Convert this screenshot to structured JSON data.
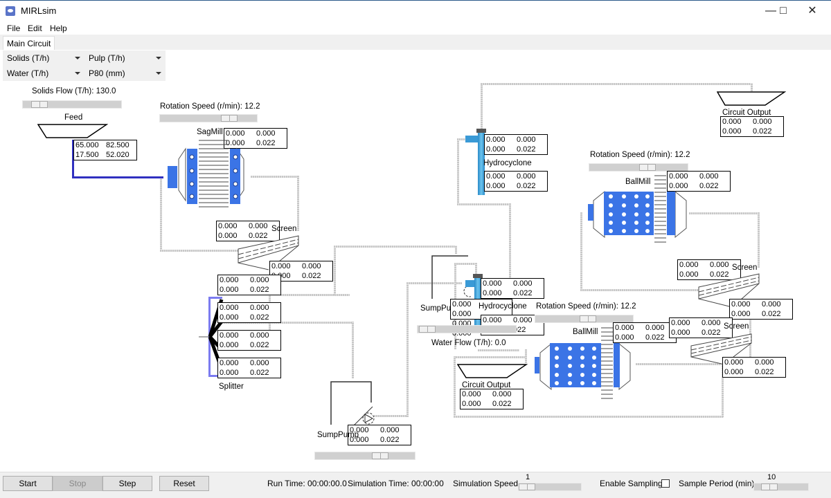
{
  "window": {
    "title": "MIRLsim",
    "minimize_icon": "minimize-icon",
    "maximize_icon": "maximize-icon",
    "close_icon": "close-icon"
  },
  "menu": [
    "File",
    "Edit",
    "Help"
  ],
  "tabs": [
    {
      "label": "Main Circuit",
      "active": true
    }
  ],
  "dropdowns": {
    "top_left": "Solids (T/h)",
    "top_right": "Pulp (T/h)",
    "bottom_left": "Water (T/h)",
    "bottom_right": "P80 (mm)"
  },
  "units": {
    "feed": {
      "label": "Feed",
      "slider_label": "Solids Flow (T/h): 130.0",
      "slider_fraction": 0.1,
      "values": [
        [
          "65.000",
          "82.500"
        ],
        [
          "17.500",
          "52.020"
        ]
      ]
    },
    "sagmill": {
      "label": "SagMill",
      "slider_label": "Rotation Speed (r/min): 12.2",
      "slider_fraction": 0.8,
      "values": [
        [
          "0.000",
          "0.000"
        ],
        [
          "0.000",
          "0.022"
        ]
      ]
    },
    "screen1": {
      "label": "Screen",
      "values_top": [
        [
          "0.000",
          "0.000"
        ],
        [
          "0.000",
          "0.022"
        ]
      ],
      "values_bottom": [
        [
          "0.000",
          "0.000"
        ],
        [
          "0.000",
          "0.022"
        ]
      ]
    },
    "splitter": {
      "label": "Splitter",
      "values": [
        [
          [
            "0.000",
            "0.000"
          ],
          [
            "0.000",
            "0.022"
          ]
        ],
        [
          [
            "0.000",
            "0.000"
          ],
          [
            "0.000",
            "0.022"
          ]
        ],
        [
          [
            "0.000",
            "0.000"
          ],
          [
            "0.000",
            "0.022"
          ]
        ],
        [
          [
            "0.000",
            "0.000"
          ],
          [
            "0.000",
            "0.022"
          ]
        ]
      ]
    },
    "sumppump1": {
      "label": "SumpPump",
      "slider_fraction": 0.6,
      "values": [
        [
          "0.000",
          "0.000"
        ],
        [
          "0.000",
          "0.022"
        ]
      ]
    },
    "hydrocyclone_top": {
      "label": "Hydrocyclone",
      "values_top": [
        [
          "0.000",
          "0.000"
        ],
        [
          "0.000",
          "0.022"
        ]
      ],
      "values_bottom": [
        [
          "0.000",
          "0.000"
        ],
        [
          "0.000",
          "0.022"
        ]
      ]
    },
    "circuit_output_top": {
      "label": "Circuit Output",
      "values": [
        [
          "0.000",
          "0.000"
        ],
        [
          "0.000",
          "0.022"
        ]
      ]
    },
    "ballmill_top": {
      "label": "BallMill",
      "slider_label": "Rotation Speed (r/min): 12.2",
      "slider_fraction": 0.6,
      "values": [
        [
          "0.000",
          "0.000"
        ],
        [
          "0.000",
          "0.022"
        ]
      ]
    },
    "screen2": {
      "label": "Screen",
      "values_top": [
        [
          "0.000",
          "0.000"
        ],
        [
          "0.000",
          "0.022"
        ]
      ],
      "values_bottom": [
        [
          "0.000",
          "0.000"
        ],
        [
          "0.000",
          "0.022"
        ]
      ]
    },
    "sumppump2": {
      "label": "SumpPump",
      "slider_label": "Water Flow (T/h): 0.0",
      "slider_fraction": 0.0,
      "values": [
        [
          "0.000",
          "0.000"
        ],
        [
          "0.000",
          "0.000"
        ]
      ]
    },
    "hydrocyclone_mid": {
      "label": "Hydrocyclone",
      "values_top": [
        [
          "0.000",
          "0.000"
        ],
        [
          "0.000",
          "0.022"
        ]
      ],
      "values_bottom": [
        [
          "0.000",
          "0.000"
        ],
        [
          "",
          "022"
        ]
      ]
    },
    "ballmill_bottom": {
      "label": "BallMill",
      "slider_label": "Rotation Speed (r/min): 12.2",
      "slider_fraction": 0.6,
      "values": [
        [
          "0.000",
          "0.000"
        ],
        [
          "0.000",
          "0.022"
        ]
      ]
    },
    "screen3": {
      "label": "Screen",
      "values_top": [
        [
          "0.000",
          "0.000"
        ],
        [
          "0.000",
          "0.022"
        ]
      ],
      "values_bottom": [
        [
          "0.000",
          "0.000"
        ],
        [
          "0.000",
          "0.022"
        ]
      ]
    },
    "circuit_output_bottom": {
      "label": "Circuit Output",
      "values": [
        [
          "0.000",
          "0.000"
        ],
        [
          "0.000",
          "0.022"
        ]
      ]
    },
    "screen2_top_extra": {
      "values": [
        [
          "0.000",
          "0.000"
        ],
        [
          "0.000",
          "0.022"
        ]
      ]
    }
  },
  "bottom": {
    "start": "Start",
    "stop": "Stop",
    "step": "Step",
    "reset": "Reset",
    "run_time": "Run Time: 00:00:00.0",
    "sim_time": "Simulation Time: 00:00:00",
    "sim_speed_label": "Simulation Speed",
    "sim_speed_value": "1",
    "enable_sampling": "Enable Sampling",
    "enable_sampling_checked": false,
    "sample_period_label": "Sample Period (min)",
    "sample_period_value": "10"
  }
}
